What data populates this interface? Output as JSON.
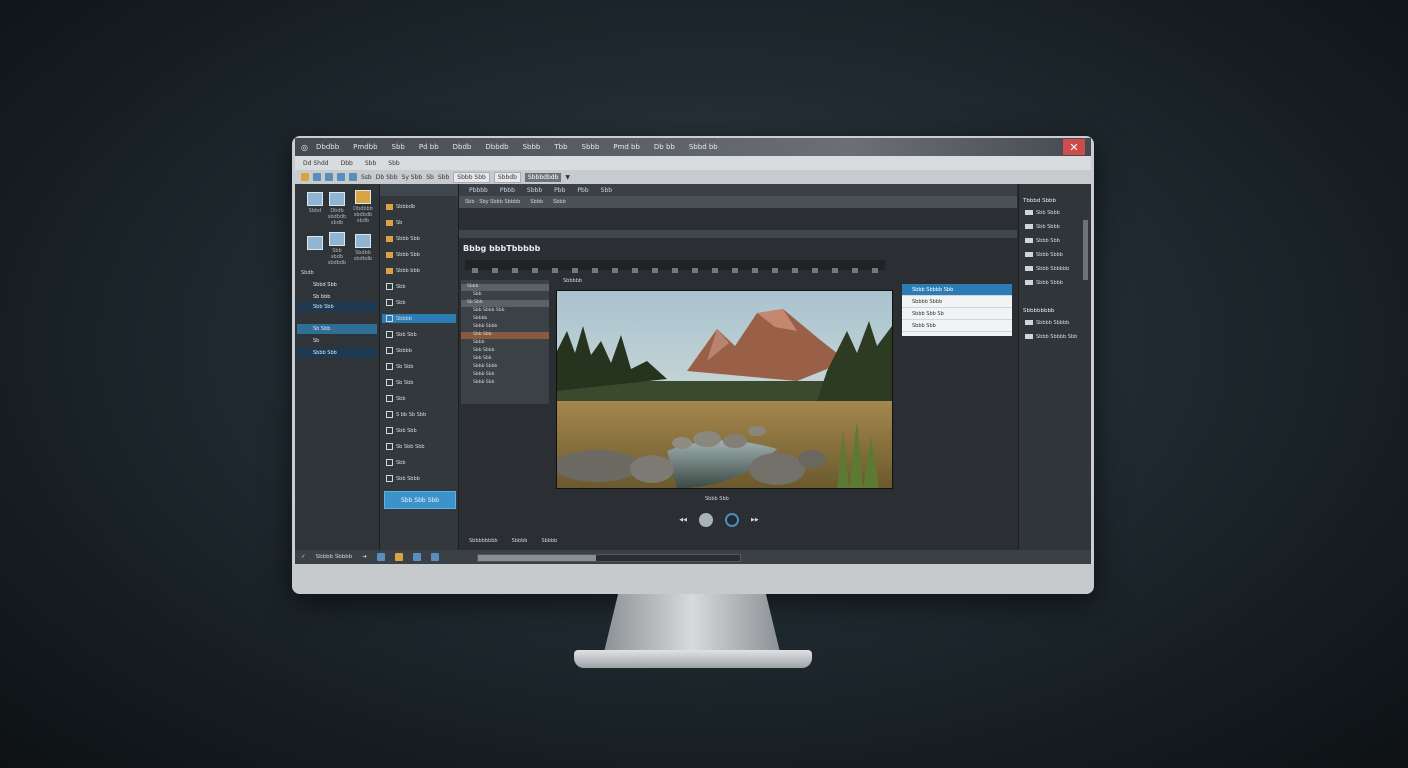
{
  "window": {
    "menu_items": [
      "Dbdbb",
      "Pmdbb",
      "Sbb",
      "Pd bb",
      "Dbdb",
      "Dbbdb",
      "Sbbb",
      "Tbb",
      "Sbbb",
      "Pmd bb",
      "Db bb",
      "Sbbd bb"
    ],
    "close_label": "✕"
  },
  "menubar": {
    "items": [
      "Dd Shdd",
      "Dbb",
      "Sbb",
      "Sbb"
    ]
  },
  "toolbar": {
    "items": [
      "Ssb",
      "Db Sbb",
      "Sy Sbb",
      "Sb",
      "Sbb"
    ],
    "field_value": "Sbbb Sbb",
    "field2_value": "Sbbdb",
    "dropdown_value": "Sbbbdbdb"
  },
  "left_panel": {
    "icons": [
      {
        "label": "Sbbd"
      },
      {
        "label": "Dbdb\nsbdbdb\nsbdb"
      },
      {
        "label": "Dbdbbb\nsbdbdb\nsbdb"
      },
      {
        "label": ""
      },
      {
        "label": "Sbb\nsbdb\nsbdbdb"
      },
      {
        "label": "Sbdbb\nsbdbdb"
      }
    ],
    "group_label": "Sbdb",
    "rows": [
      "Sbbd Sbb",
      "Sb bbb",
      "Sbb Sbb",
      "Sb Sbb",
      "Sb",
      "Sbbb Sbb"
    ]
  },
  "tree": {
    "rows": [
      "Sbbbdb",
      "Sb",
      "Sbbb Sbb",
      "Sbbb Sbb",
      "Sbbb bbb",
      "Sbb",
      "Sbb",
      "Sbbbb",
      "Sbb Sbb",
      "Sbbbb",
      "Sb Sbb",
      "Sb Sbb",
      "Sbb",
      "S bb Sb Sbb",
      "Sbb Sbb",
      "Sb Sbb Sbb",
      "Sbb",
      "Sbb Sbbb"
    ],
    "button_label": "Sbb Sbb Sbb"
  },
  "center": {
    "tabs": [
      "Pbbbb",
      "Pbbb",
      "Sbbb",
      "Pbb",
      "Pbb",
      "Sbb"
    ],
    "subbar": [
      "Sbb · Sby Sbbb Sbbbb",
      "Sbbb",
      "Sbbb"
    ],
    "section_title": "Bbbg bbbTbbbbb",
    "layers": [
      "Sbbb",
      "Sbb",
      "Sb Sbb",
      "Sbb Sbbb Sbb",
      "Sbbbb",
      "Sbbb Sbbb",
      "Sbb Sbb",
      "Sbbb",
      "Sbb Sbbb",
      "Sbb Sbb",
      "Sbbb Sbbb",
      "Sbbb Sbb",
      "Sbbb Sbb"
    ],
    "canvas_label": "Sbbbbb",
    "props": [
      "Sbbb Sbbbb Sbb",
      "Sbbbb Sbbb",
      "Sbbb Sbb Sb",
      "Sbbb Sbb"
    ],
    "play_caption": "Sbbb Sbb",
    "bottom_items": [
      "Sbbbbbbbb",
      "Sbbbb",
      "Sbbbb"
    ]
  },
  "right_panel": {
    "header": "Tbbbd Sbbb",
    "rows": [
      "Sbb Sbbb",
      "Sbb Sbbb",
      "Sbbb Sbb",
      "Sbbb Sbbb",
      "Sbbb Sbbbbb",
      "Sbbb Sbbb"
    ],
    "section2": "Sbbbbbbbb",
    "rows2": [
      "Sbbbb Sbbbb",
      "Sbbb Sbbbb Sbb"
    ]
  },
  "statusbar": {
    "left_text": "Sbbbb Sbbbb",
    "progress": 0.45
  }
}
